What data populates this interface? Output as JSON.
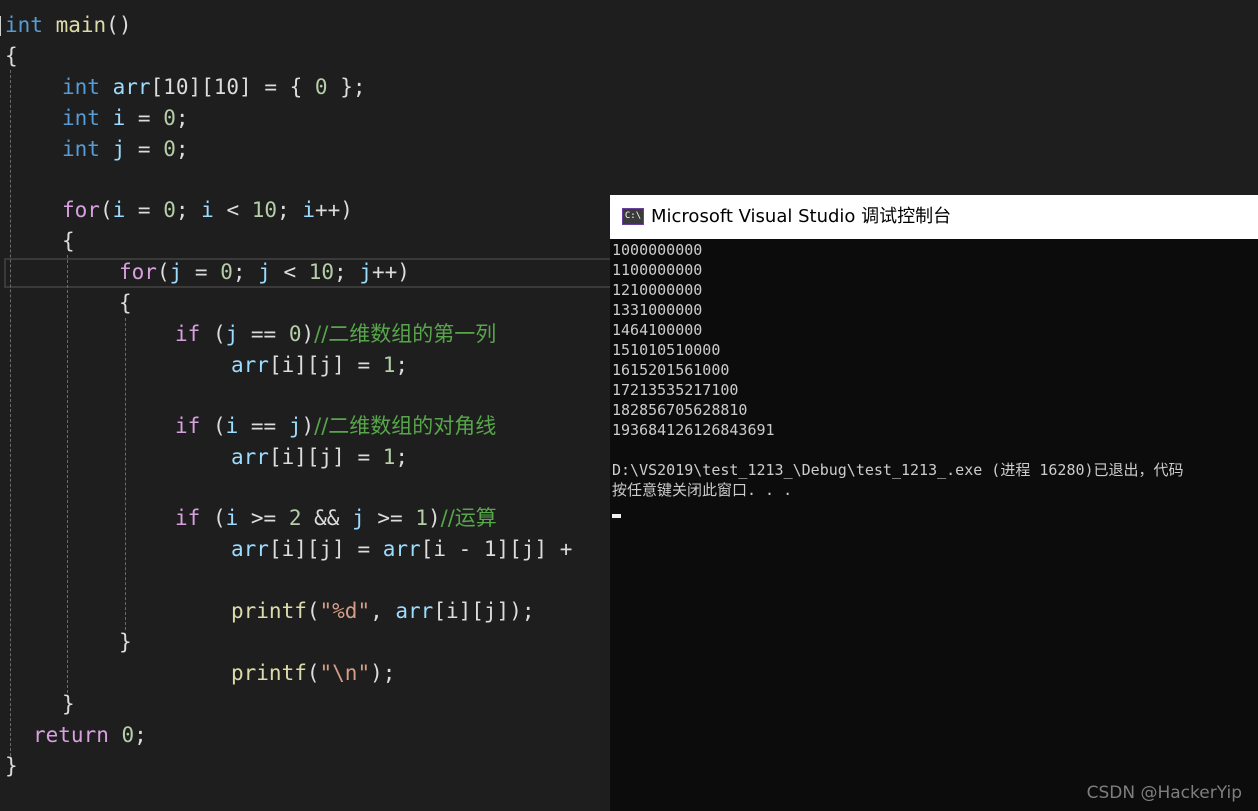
{
  "editor": {
    "tokens": {
      "int": "int",
      "main": "main",
      "paren_pair": "()",
      "open_brace": "{",
      "close_brace": "}",
      "arr_name": "arr",
      "arr_decl_dims": "[10][10]",
      "arr_decl_init_a": " = { ",
      "arr_decl_zero": "0",
      "arr_decl_init_b": " };",
      "i": "i",
      "j": "j",
      "assign": " = ",
      "zero": "0",
      "semicolon": ";",
      "for": "for",
      "open_paren": "(",
      "close_paren": ")",
      "semi_space": "; ",
      "lt": " < ",
      "ten": "10",
      "incr": "++",
      "if": "if",
      "eqeq": " == ",
      "ge": " >= ",
      "two": "2",
      "and": " && ",
      "one": "1",
      "index_ij": "[i][j]",
      "rhs_index": "[i - 1][j] +",
      "printf": "printf",
      "fmt_d": "\"%d\"",
      "comma_sp": ", ",
      "close_paren_semi": ");",
      "newline_str": "\"\\n\"",
      "return": "return"
    },
    "comments": {
      "first_col": "//二维数组的第一列",
      "diagonal": "//二维数组的对角线",
      "compute": "//运算"
    }
  },
  "console": {
    "title": "Microsoft Visual Studio 调试控制台",
    "icon_text": "C:\\",
    "output_lines": [
      "1000000000",
      "1100000000",
      "1210000000",
      "1331000000",
      "1464100000",
      "151010510000",
      "1615201561000",
      "17213535217100",
      "182856705628810",
      "193684126126843691"
    ],
    "exit_message": "D:\\VS2019\\test_1213_\\Debug\\test_1213_.exe (进程 16280)已退出，代码",
    "press_key": "按任意键关闭此窗口. . ."
  },
  "watermark": "CSDN @HackerYip"
}
